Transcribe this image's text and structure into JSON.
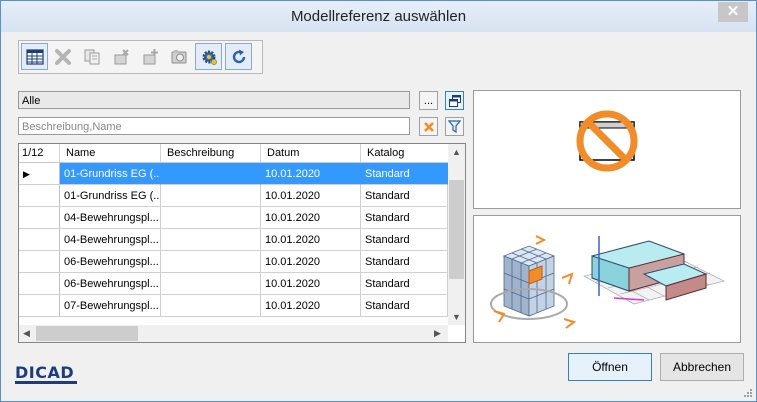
{
  "window": {
    "title": "Modellreferenz auswählen",
    "close_glyph": "✕"
  },
  "toolbar": {
    "buttons": [
      {
        "name": "table-view-icon",
        "enabled": true
      },
      {
        "name": "delete-icon",
        "enabled": false
      },
      {
        "name": "copy-icon",
        "enabled": false
      },
      {
        "name": "remove-reference-icon",
        "enabled": false
      },
      {
        "name": "add-reference-icon",
        "enabled": false
      },
      {
        "name": "camera-icon",
        "enabled": false
      },
      {
        "name": "settings-gear-icon",
        "enabled": true
      },
      {
        "name": "refresh-icon",
        "enabled": true
      }
    ]
  },
  "filter": {
    "scope_value": "Alle",
    "browse_label": "...",
    "search_placeholder": "Beschreibung,Name"
  },
  "grid": {
    "counter": "1/12",
    "columns": [
      "Name",
      "Beschreibung",
      "Datum",
      "Katalog"
    ],
    "rows": [
      {
        "name": "01-Grundriss EG (...",
        "beschreibung": "",
        "datum": "10.01.2020",
        "katalog": "Standard",
        "selected": true
      },
      {
        "name": "01-Grundriss EG (...",
        "beschreibung": "",
        "datum": "10.01.2020",
        "katalog": "Standard",
        "selected": false
      },
      {
        "name": "04-Bewehrungspl...",
        "beschreibung": "",
        "datum": "10.01.2020",
        "katalog": "Standard",
        "selected": false
      },
      {
        "name": "04-Bewehrungspl...",
        "beschreibung": "",
        "datum": "10.01.2020",
        "katalog": "Standard",
        "selected": false
      },
      {
        "name": "06-Bewehrungspl...",
        "beschreibung": "",
        "datum": "10.01.2020",
        "katalog": "Standard",
        "selected": false
      },
      {
        "name": "06-Bewehrungspl...",
        "beschreibung": "",
        "datum": "10.01.2020",
        "katalog": "Standard",
        "selected": false
      },
      {
        "name": "07-Bewehrungspl...",
        "beschreibung": "",
        "datum": "10.01.2020",
        "katalog": "Standard",
        "selected": false
      }
    ]
  },
  "buttons": {
    "open": "Öffnen",
    "cancel": "Abbrechen"
  },
  "logo": {
    "text": "DICAD"
  },
  "colors": {
    "selection": "#3399ff",
    "accent_orange": "#f28c28"
  }
}
